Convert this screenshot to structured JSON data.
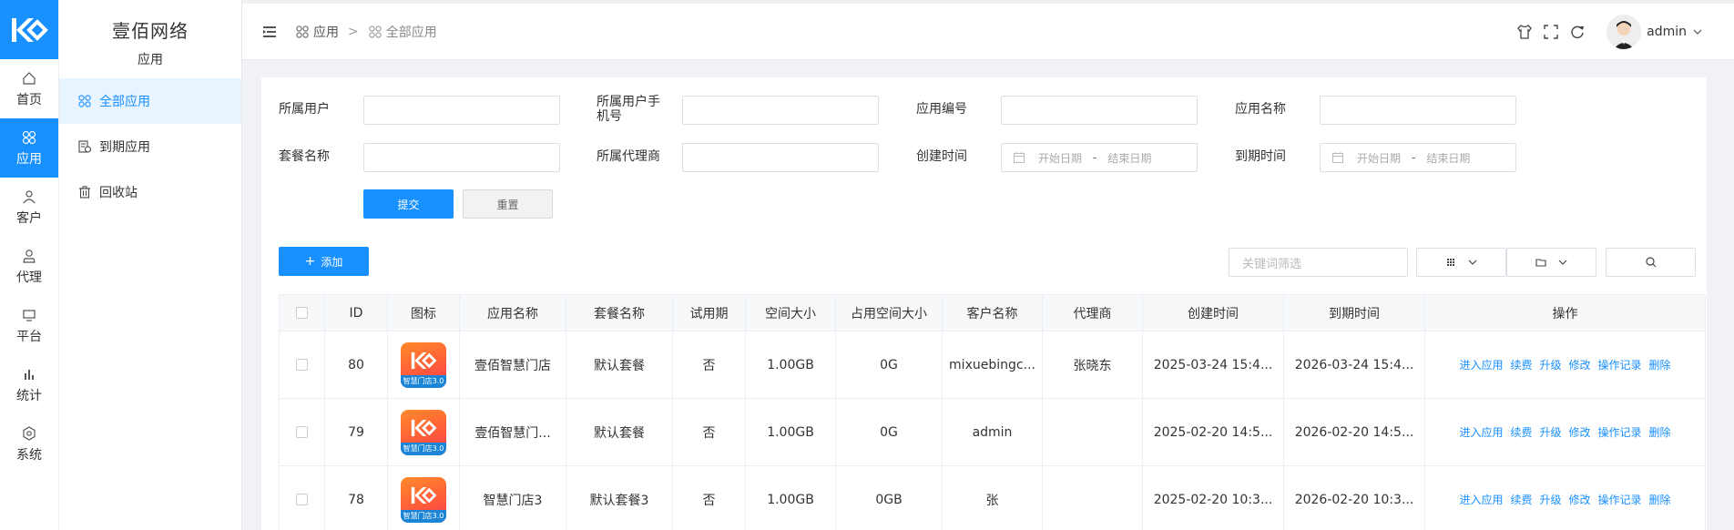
{
  "brand": {
    "title": "壹佰网络",
    "subtitle": "应用"
  },
  "rail": [
    {
      "label": "首页",
      "icon": "home-icon"
    },
    {
      "label": "应用",
      "icon": "apps-icon",
      "active": true
    },
    {
      "label": "客户",
      "icon": "user-icon"
    },
    {
      "label": "代理",
      "icon": "agent-icon"
    },
    {
      "label": "平台",
      "icon": "monitor-icon"
    },
    {
      "label": "统计",
      "icon": "bar-chart-icon"
    },
    {
      "label": "系统",
      "icon": "settings-icon"
    }
  ],
  "submenu": [
    {
      "label": "全部应用",
      "icon": "apps-icon",
      "active": true
    },
    {
      "label": "到期应用",
      "icon": "expire-icon"
    },
    {
      "label": "回收站",
      "icon": "trash-icon"
    }
  ],
  "breadcrumb": {
    "first": "应用",
    "separator": ">",
    "last": "全部应用"
  },
  "user": {
    "name": "admin"
  },
  "filters": {
    "owner_user": "所属用户",
    "owner_phone": "所属用户手机号",
    "app_no": "应用编号",
    "app_name": "应用名称",
    "package_name": "套餐名称",
    "agent": "所属代理商",
    "create_time": "创建时间",
    "expire_time": "到期时间",
    "start_placeholder": "开始日期",
    "date_sep": "-",
    "end_placeholder": "结束日期"
  },
  "buttons": {
    "submit": "提交",
    "reset": "重置",
    "add": "添加",
    "add_prefix": "+"
  },
  "keyword_placeholder": "关键词筛选",
  "table": {
    "headers": [
      "ID",
      "图标",
      "应用名称",
      "套餐名称",
      "试用期",
      "空间大小",
      "占用空间大小",
      "客户名称",
      "代理商",
      "创建时间",
      "到期时间",
      "操作"
    ],
    "icon_tag": "智慧门店3.0",
    "ops": [
      "进入应用",
      "续费",
      "升级",
      "修改",
      "操作记录",
      "删除"
    ],
    "rows": [
      {
        "id": "80",
        "name": "壹佰智慧门店",
        "package": "默认套餐",
        "trial": "否",
        "space": "1.00GB",
        "used": "0G",
        "customer": "mixuebingc...",
        "agent": "张晓东",
        "created": "2025-03-24 15:4...",
        "expires": "2026-03-24 15:4..."
      },
      {
        "id": "79",
        "name": "壹佰智慧门...",
        "package": "默认套餐",
        "trial": "否",
        "space": "1.00GB",
        "used": "0G",
        "customer": "admin",
        "agent": "",
        "created": "2025-02-20 14:5...",
        "expires": "2026-02-20 14:5..."
      },
      {
        "id": "78",
        "name": "智慧门店3",
        "package": "默认套餐3",
        "trial": "否",
        "space": "1.00GB",
        "used": "0GB",
        "customer": "张",
        "agent": "",
        "created": "2025-02-20 10:3...",
        "expires": "2026-02-20 10:3..."
      }
    ]
  },
  "colors": {
    "primary": "#1890ff",
    "active_submenu_bg": "#e8f4ff"
  }
}
